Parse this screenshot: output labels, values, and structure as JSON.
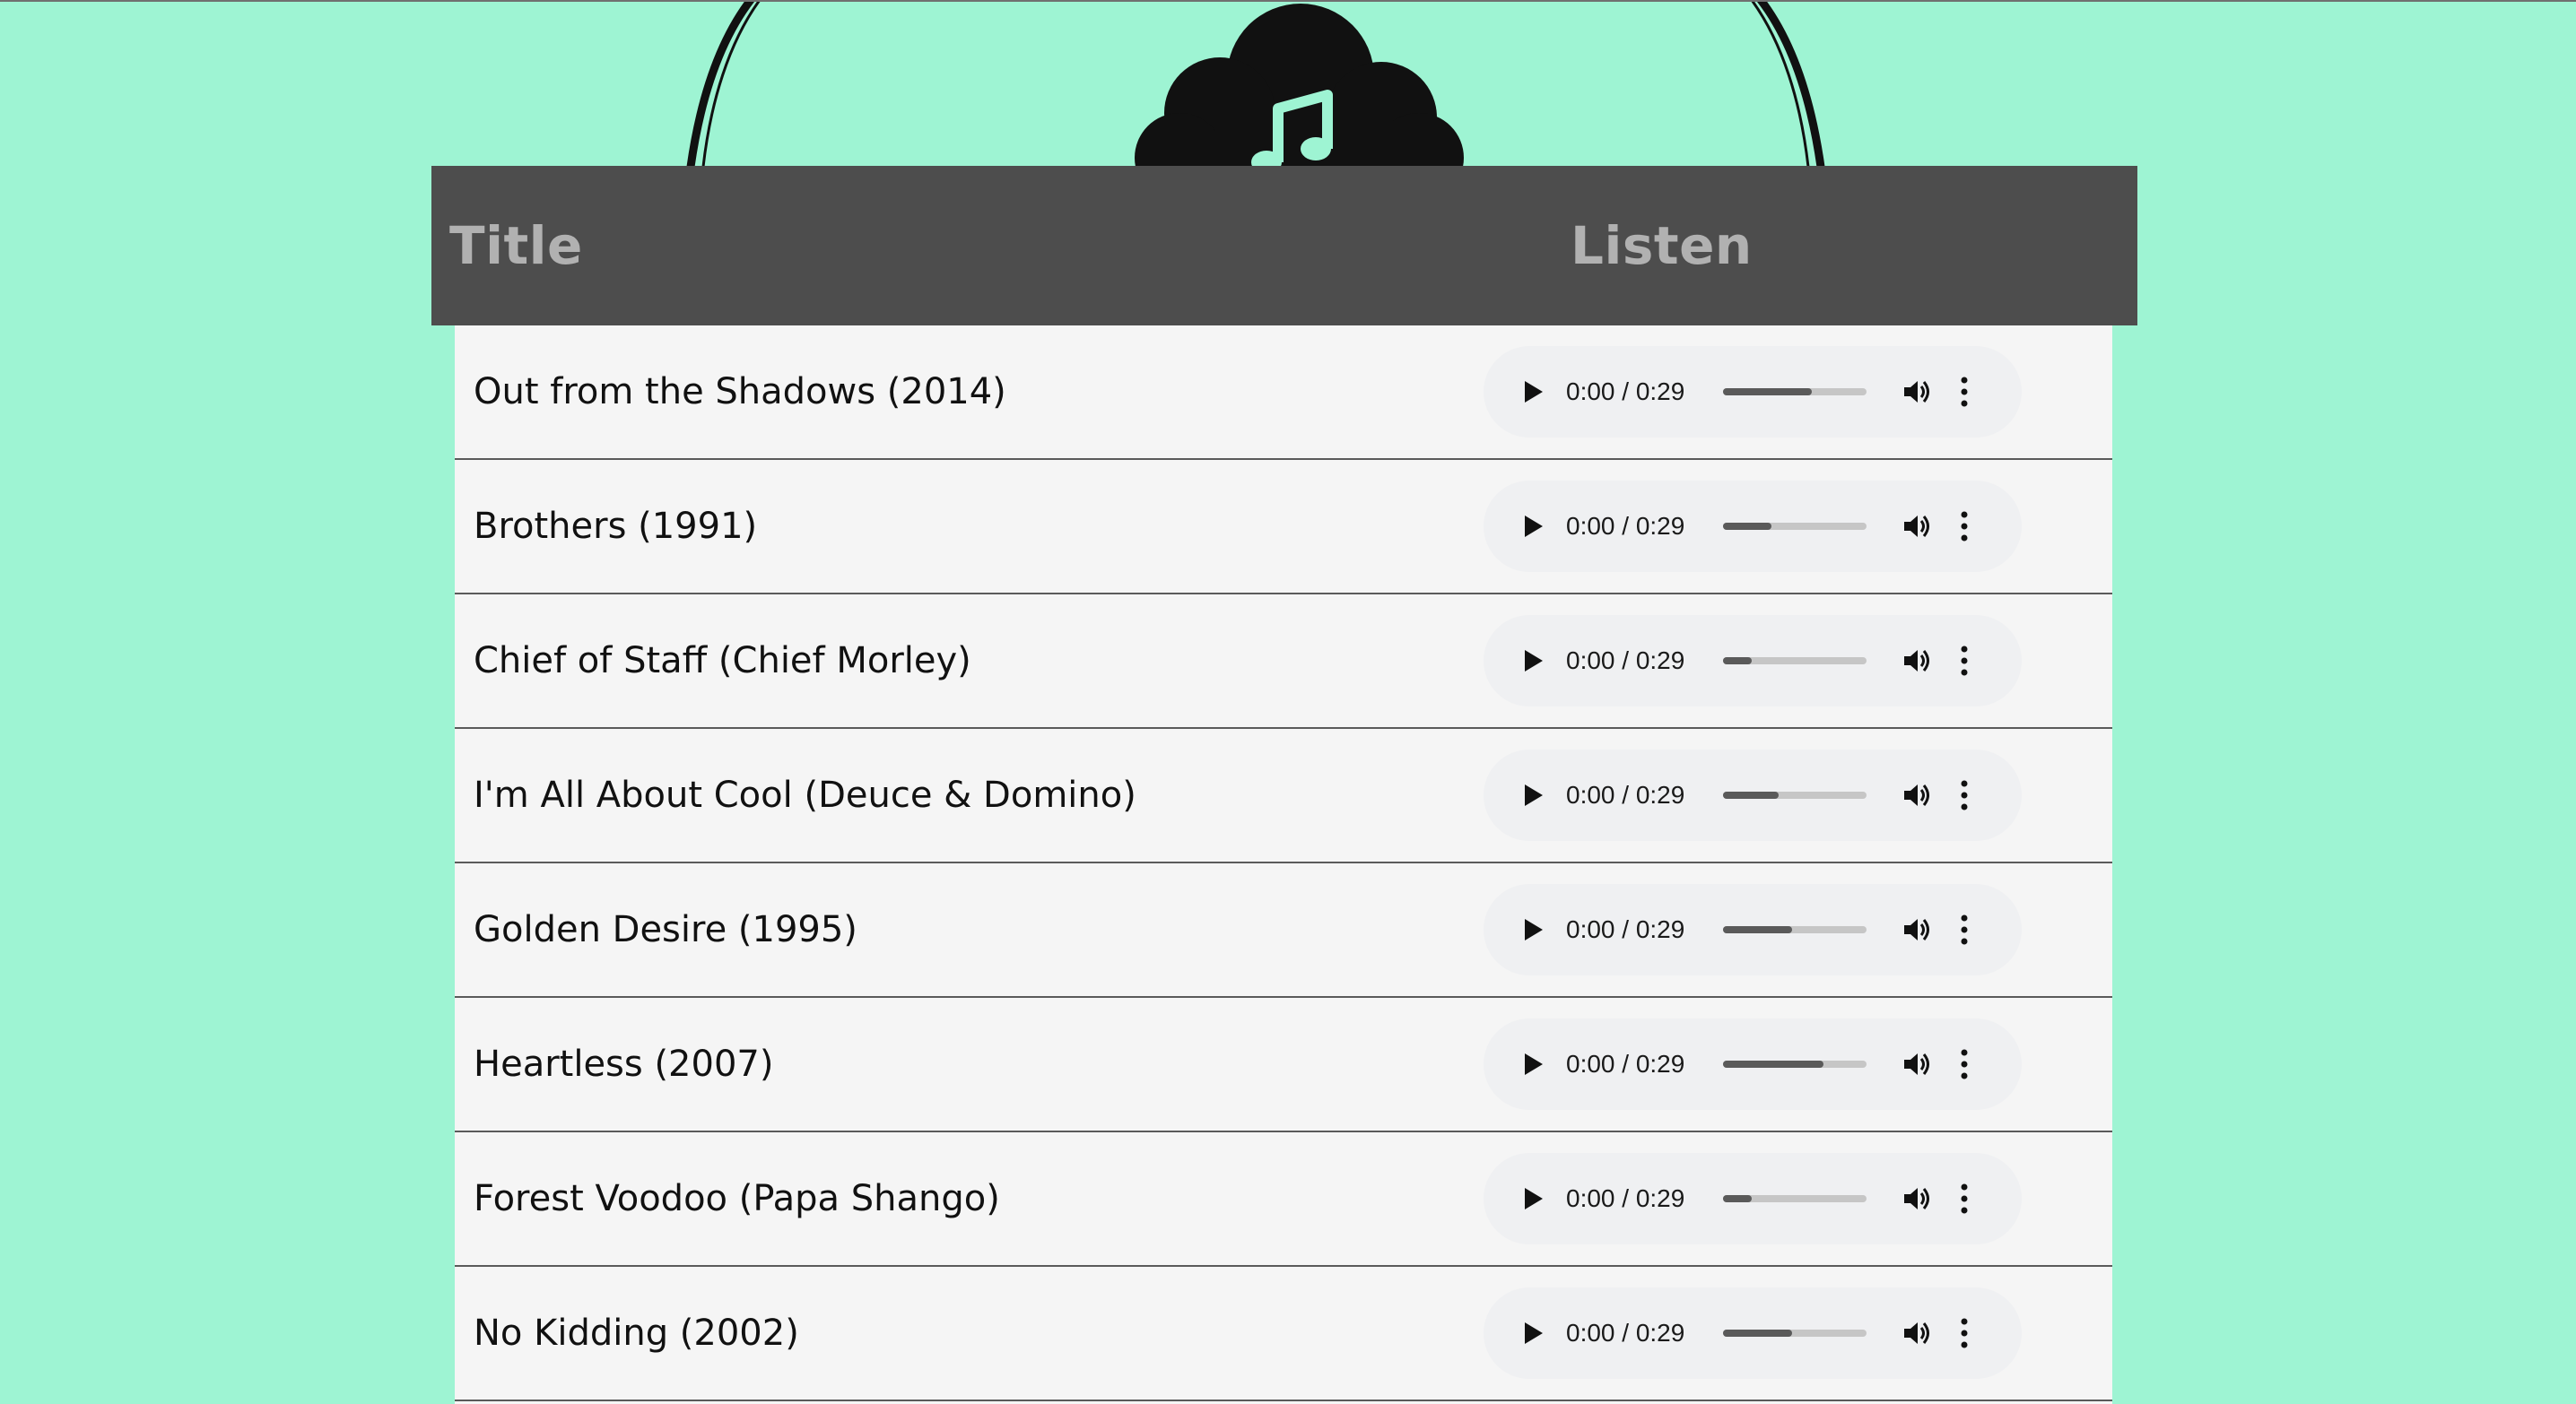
{
  "header": {
    "title_col": "Title",
    "listen_col": "Listen"
  },
  "logo": {
    "icon": "music-note-cloud-icon",
    "color": "#111111"
  },
  "colors": {
    "background": "#9ef4d3",
    "header_bg": "#4d4d4d",
    "header_text": "#b1b1b1",
    "row_bg": "#f5f5f5"
  },
  "songs": [
    {
      "title": "Out from the Shadows (2014)",
      "time": "0:00 / 0:29",
      "level": 0.62
    },
    {
      "title": "Brothers (1991)",
      "time": "0:00 / 0:29",
      "level": 0.34
    },
    {
      "title": "Chief of Staff (Chief Morley)",
      "time": "0:00 / 0:29",
      "level": 0.2
    },
    {
      "title": "I'm All About Cool (Deuce & Domino)",
      "time": "0:00 / 0:29",
      "level": 0.39
    },
    {
      "title": "Golden Desire (1995)",
      "time": "0:00 / 0:29",
      "level": 0.48
    },
    {
      "title": "Heartless (2007)",
      "time": "0:00 / 0:29",
      "level": 0.7
    },
    {
      "title": "Forest Voodoo (Papa Shango)",
      "time": "0:00 / 0:29",
      "level": 0.2
    },
    {
      "title": "No Kidding (2002)",
      "time": "0:00 / 0:29",
      "level": 0.48
    }
  ]
}
